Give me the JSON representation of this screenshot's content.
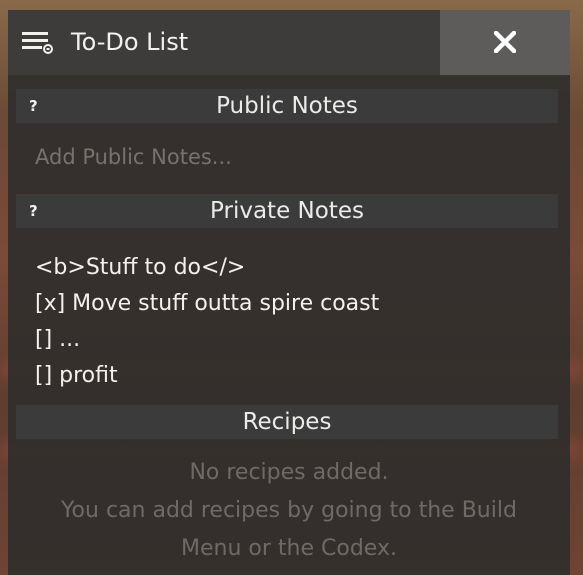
{
  "window": {
    "title": "To-Do List",
    "close_label": "✕"
  },
  "public_notes": {
    "help": "?",
    "header": "Public Notes",
    "placeholder": "Add Public Notes..."
  },
  "private_notes": {
    "help": "?",
    "header": "Private Notes",
    "lines": [
      "<b>Stuff to do</>",
      "[x] Move stuff outta spire coast",
      "[] ...",
      "[] profit"
    ]
  },
  "recipes": {
    "header": "Recipes",
    "empty_line1": "No recipes added.",
    "empty_line2": "You can add recipes by going to the Build",
    "empty_line3": "Menu or the Codex."
  },
  "icons": {
    "menu": "list-menu-icon",
    "close": "close-icon"
  }
}
